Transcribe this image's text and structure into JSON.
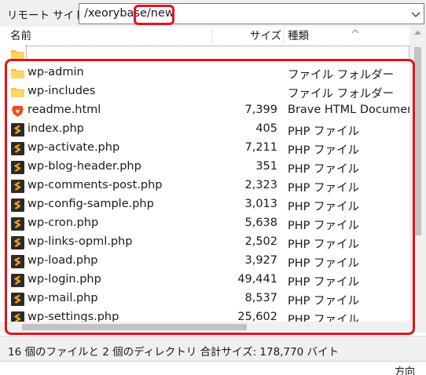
{
  "address_bar": {
    "label": "リモート サイト:",
    "value": "/xeorybase/new"
  },
  "columns": {
    "name": "名前",
    "size": "サイズ",
    "type": "種類"
  },
  "list": {
    "rows": [
      {
        "name": "",
        "size": "",
        "type": "",
        "icon": "folder-icon"
      },
      {
        "name": "wp-admin",
        "size": "",
        "type": "ファイル フォルダー",
        "icon": "folder-icon"
      },
      {
        "name": "wp-includes",
        "size": "",
        "type": "ファイル フォルダー",
        "icon": "folder-icon"
      },
      {
        "name": "readme.html",
        "size": "7,399",
        "type": "Brave HTML Document",
        "icon": "brave-icon"
      },
      {
        "name": "index.php",
        "size": "405",
        "type": "PHP ファイル",
        "icon": "php-file-icon"
      },
      {
        "name": "wp-activate.php",
        "size": "7,211",
        "type": "PHP ファイル",
        "icon": "php-file-icon"
      },
      {
        "name": "wp-blog-header.php",
        "size": "351",
        "type": "PHP ファイル",
        "icon": "php-file-icon"
      },
      {
        "name": "wp-comments-post.php",
        "size": "2,323",
        "type": "PHP ファイル",
        "icon": "php-file-icon"
      },
      {
        "name": "wp-config-sample.php",
        "size": "3,013",
        "type": "PHP ファイル",
        "icon": "php-file-icon"
      },
      {
        "name": "wp-cron.php",
        "size": "5,638",
        "type": "PHP ファイル",
        "icon": "php-file-icon"
      },
      {
        "name": "wp-links-opml.php",
        "size": "2,502",
        "type": "PHP ファイル",
        "icon": "php-file-icon"
      },
      {
        "name": "wp-load.php",
        "size": "3,927",
        "type": "PHP ファイル",
        "icon": "php-file-icon"
      },
      {
        "name": "wp-login.php",
        "size": "49,441",
        "type": "PHP ファイル",
        "icon": "php-file-icon"
      },
      {
        "name": "wp-mail.php",
        "size": "8,537",
        "type": "PHP ファイル",
        "icon": "php-file-icon"
      },
      {
        "name": "wp-settings.php",
        "size": "25,602",
        "type": "PHP ファイル",
        "icon": "php-file-icon"
      }
    ]
  },
  "status_bar": {
    "text": "16 個のファイルと 2 個のディレクトリ 合計サイズ: 178,770 バイト"
  },
  "bottom_fragment": "方向",
  "colors": {
    "highlight": "#e0141e",
    "folder": "#f5c242",
    "php_icon": "#2b2b2b",
    "php_accent": "#f0a020",
    "brave": "#f04a1c"
  }
}
